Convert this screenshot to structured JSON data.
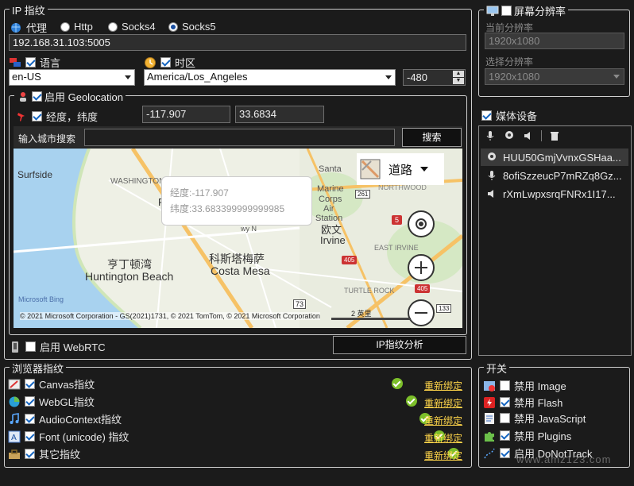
{
  "ip": {
    "legend": "IP 指纹",
    "proxy_label": "代理",
    "radios": [
      "Http",
      "Socks4",
      "Socks5"
    ],
    "address": "192.168.31.103:5005",
    "language_label": "语言",
    "timezone_label": "时区",
    "language_value": "en-US",
    "timezone_value": "America/Los_Angeles",
    "offset_value": "-480"
  },
  "geo": {
    "legend": "启用 Geolocation",
    "latlon_label": "经度，纬度",
    "lon": "-117.907",
    "lat": "33.6834",
    "search_label": "输入城市搜索",
    "search_placeholder": "",
    "search_button": "搜索"
  },
  "map": {
    "popup_lon": "经度:-117.907",
    "popup_lat": "纬度:33.683399999999985",
    "road_label": "道路",
    "places": {
      "surfside": "Surfside",
      "washington": "WASHINGTON",
      "santa_ana": "Santa",
      "marine": "Marine",
      "corps": "Corps",
      "air": "Air",
      "station": "Station",
      "irvine_cn": "欧文",
      "irvine": "Irvine",
      "hb_cn": "亨丁顿湾",
      "hb": "Huntington Beach",
      "cm_cn": "科斯塔梅萨",
      "cm": "Costa Mesa",
      "east_irvine": "EAST IRVINE",
      "turtle_rock": "TURTLE ROCK",
      "northwood": "NORTHWOOD",
      "route_261": "261",
      "route_5": "5",
      "route_405": "405",
      "route_73": "73",
      "route_133": "133",
      "fwy": "wy N",
      "f": "F"
    },
    "bing": "Microsoft Bing",
    "copyright": "© 2021 Microsoft Corporation - GS(2021)1731, © 2021 TomTom, © 2021 Microsoft Corporation",
    "scale": "2 英里"
  },
  "webrtc_label": "启用 WebRTC",
  "analyze_button": "IP指纹分析",
  "browser": {
    "legend": "浏览器指纹",
    "items": [
      {
        "label": "Canvas指纹",
        "link": "重新绑定"
      },
      {
        "label": "WebGL指纹",
        "link": "重新绑定"
      },
      {
        "label": "AudioContext指纹",
        "link": "重新绑定"
      },
      {
        "label": "Font (unicode) 指纹",
        "link": "重新绑定"
      },
      {
        "label": "其它指纹",
        "link": "重新绑定"
      }
    ]
  },
  "screen": {
    "legend": "屏幕分辨率",
    "current_label": "当前分辨率",
    "current_value": "1920x1080",
    "select_label": "选择分辨率",
    "select_value": "1920x1080"
  },
  "media": {
    "label": "媒体设备",
    "devices": [
      "HUU50GmjVvnxGSHaa...",
      "8ofiSzzeucP7mRZq8Gz...",
      "rXmLwpxsrqFNRx1I17..."
    ]
  },
  "switches": {
    "legend": "开关",
    "items": [
      "禁用 Image",
      "禁用 Flash",
      "禁用 JavaScript",
      "禁用 Plugins",
      "启用 DoNotTrack"
    ]
  },
  "watermark": "www.amz123.com"
}
